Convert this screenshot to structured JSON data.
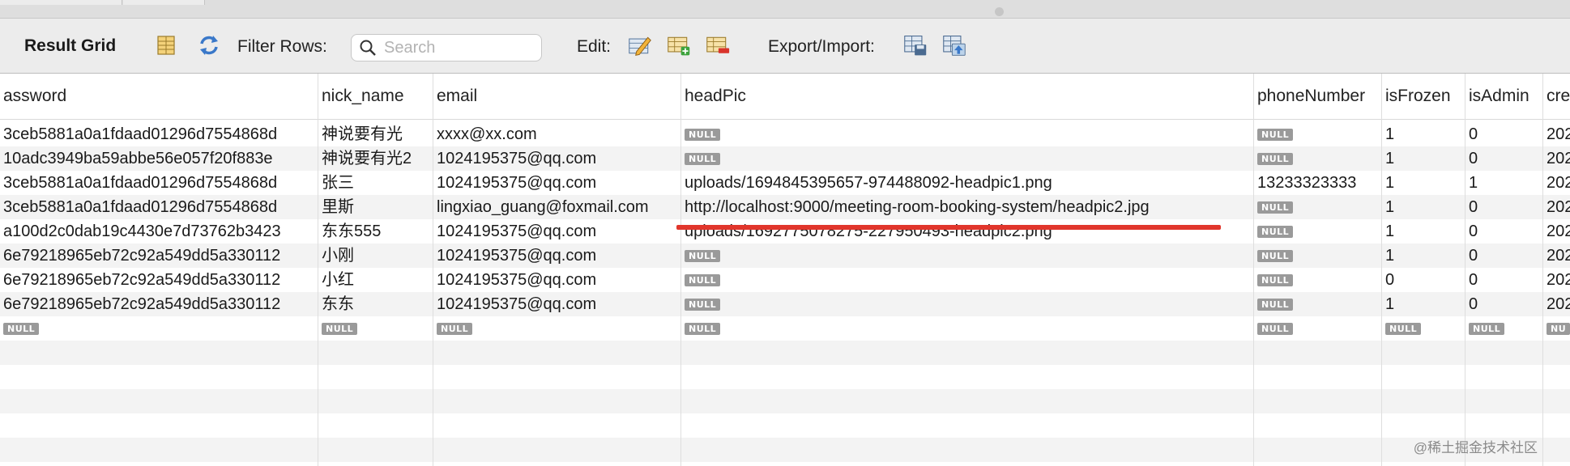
{
  "toolbar": {
    "title": "Result Grid",
    "filter_label": "Filter Rows:",
    "search_placeholder": "Search",
    "edit_label": "Edit:",
    "export_label": "Export/Import:",
    "icons": [
      "grid-layout-icon",
      "refresh-icon",
      "search-icon",
      "edit-cell-icon",
      "add-row-icon",
      "delete-row-icon",
      "export-icon",
      "import-icon"
    ]
  },
  "columns": [
    "assword",
    "nick_name",
    "email",
    "headPic",
    "phoneNumber",
    "isFrozen",
    "isAdmin",
    "cre"
  ],
  "null_label": "NULL",
  "rows": [
    [
      "3ceb5881a0a1fdaad01296d7554868d",
      "神说要有光",
      "xxxx@xx.com",
      "NULL",
      "NULL",
      "1",
      "0",
      "202"
    ],
    [
      "10adc3949ba59abbe56e057f20f883e",
      "神说要有光2",
      "1024195375@qq.com",
      "NULL",
      "NULL",
      "1",
      "0",
      "202"
    ],
    [
      "3ceb5881a0a1fdaad01296d7554868d",
      "张三",
      "1024195375@qq.com",
      "uploads/1694845395657-974488092-headpic1.png",
      "13233323333",
      "1",
      "1",
      "202"
    ],
    [
      "3ceb5881a0a1fdaad01296d7554868d",
      "里斯",
      "lingxiao_guang@foxmail.com",
      "http://localhost:9000/meeting-room-booking-system/headpic2.jpg",
      "NULL",
      "1",
      "0",
      "202"
    ],
    [
      "a100d2c0dab19c4430e7d73762b3423",
      "东东555",
      "1024195375@qq.com",
      "uploads/1692775078275-227950493-headpic2.png",
      "NULL",
      "1",
      "0",
      "202"
    ],
    [
      "6e79218965eb72c92a549dd5a330112",
      "小刚",
      "1024195375@qq.com",
      "NULL",
      "NULL",
      "1",
      "0",
      "202"
    ],
    [
      "6e79218965eb72c92a549dd5a330112",
      "小红",
      "1024195375@qq.com",
      "NULL",
      "NULL",
      "0",
      "0",
      "202"
    ],
    [
      "6e79218965eb72c92a549dd5a330112",
      "东东",
      "1024195375@qq.com",
      "NULL",
      "NULL",
      "1",
      "0",
      "202"
    ],
    [
      "NULL",
      "NULL",
      "NULL",
      "NULL",
      "NULL",
      "NULL",
      "NULL",
      "NU"
    ]
  ],
  "watermark": "@稀土掘金技术社区",
  "colors": {
    "annotation_underline": "#e1362c",
    "null_badge": "#9a9a9a"
  }
}
